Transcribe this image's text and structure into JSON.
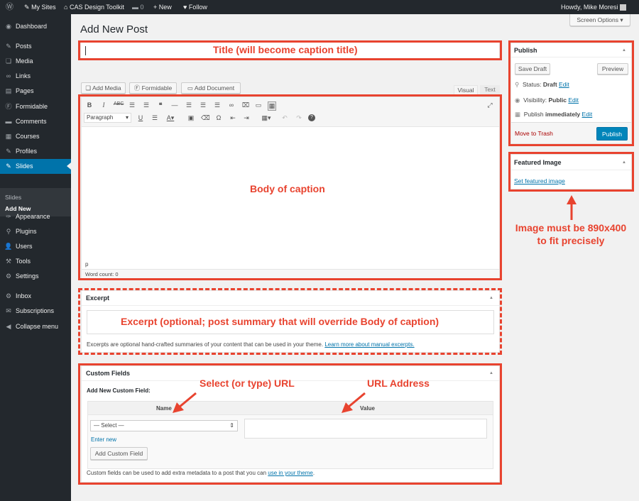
{
  "adminbar": {
    "wp_logo_icon": "wordpress-icon",
    "my_sites": "My Sites",
    "site_name": "CAS Design Toolkit",
    "comments_count": "0",
    "new_label": "New",
    "follow_label": "Follow",
    "howdy": "Howdy, Mike Moresi"
  },
  "menu": {
    "items": [
      {
        "label": "Dashboard",
        "icon": "dashboard-icon",
        "glyph": "◉"
      },
      {
        "label": "Posts",
        "icon": "pin-icon",
        "glyph": "✎"
      },
      {
        "label": "Media",
        "icon": "media-icon",
        "glyph": "❏"
      },
      {
        "label": "Links",
        "icon": "link-icon",
        "glyph": "∞"
      },
      {
        "label": "Pages",
        "icon": "page-icon",
        "glyph": "▤"
      },
      {
        "label": "Formidable",
        "icon": "formidable-icon",
        "glyph": "Ⓕ"
      },
      {
        "label": "Comments",
        "icon": "comment-icon",
        "glyph": "▬"
      },
      {
        "label": "Courses",
        "icon": "courses-icon",
        "glyph": "▦"
      },
      {
        "label": "Profiles",
        "icon": "pin-icon",
        "glyph": "✎"
      },
      {
        "label": "Slides",
        "icon": "pin-icon",
        "glyph": "✎"
      },
      {
        "label": "Appearance",
        "icon": "brush-icon",
        "glyph": "✑"
      },
      {
        "label": "Plugins",
        "icon": "plugin-icon",
        "glyph": "⚲"
      },
      {
        "label": "Users",
        "icon": "users-icon",
        "glyph": "👤"
      },
      {
        "label": "Tools",
        "icon": "tools-icon",
        "glyph": "⚒"
      },
      {
        "label": "Settings",
        "icon": "settings-icon",
        "glyph": "⚙"
      },
      {
        "label": "Inbox",
        "icon": "inbox-icon",
        "glyph": "⚙"
      },
      {
        "label": "Subscriptions",
        "icon": "mail-icon",
        "glyph": "✉"
      },
      {
        "label": "Collapse menu",
        "icon": "collapse-icon",
        "glyph": "◀"
      }
    ],
    "submenu": [
      "Slides",
      "Add New"
    ]
  },
  "page": {
    "title": "Add New Post",
    "screen_options": "Screen Options ▾"
  },
  "editor": {
    "add_media": "Add Media",
    "formidable": "Formidable",
    "add_document": "Add Document",
    "tab_visual": "Visual",
    "tab_text": "Text",
    "format_select": "Paragraph",
    "path": "p",
    "word_count": "Word count: 0"
  },
  "publish": {
    "title": "Publish",
    "save_draft": "Save Draft",
    "preview": "Preview",
    "status_label": "Status:",
    "status_value": "Draft",
    "visibility_label": "Visibility:",
    "visibility_value": "Public",
    "schedule": "Publish",
    "schedule_value": "immediately",
    "edit": "Edit",
    "move_trash": "Move to Trash",
    "publish_btn": "Publish"
  },
  "featured": {
    "title": "Featured Image",
    "set_link": "Set featured image"
  },
  "excerpt": {
    "title": "Excerpt",
    "help_text": "Excerpts are optional hand-crafted summaries of your content that can be used in your theme.",
    "help_link": "Learn more about manual excerpts."
  },
  "custom_fields": {
    "title": "Custom Fields",
    "add_new_label": "Add New Custom Field:",
    "col_name": "Name",
    "col_value": "Value",
    "select_value": "— Select —",
    "enter_new": "Enter new",
    "add_btn": "Add Custom Field",
    "help_text": "Custom fields can be used to add extra metadata to a post that you can",
    "help_link": "use in your theme",
    "help_end": "."
  },
  "annotations": {
    "title": "Title (will become caption title)",
    "body": "Body of caption",
    "excerpt": "Excerpt (optional; post summary that will override Body of caption)",
    "select_url": "Select (or type) URL",
    "url_address": "URL Address",
    "image_note_1": "Image must be 890x400",
    "image_note_2": "to fit precisely"
  },
  "colors": {
    "annotation_red": "#e8432f",
    "admin_dark": "#23282d",
    "active_blue": "#0073aa"
  }
}
